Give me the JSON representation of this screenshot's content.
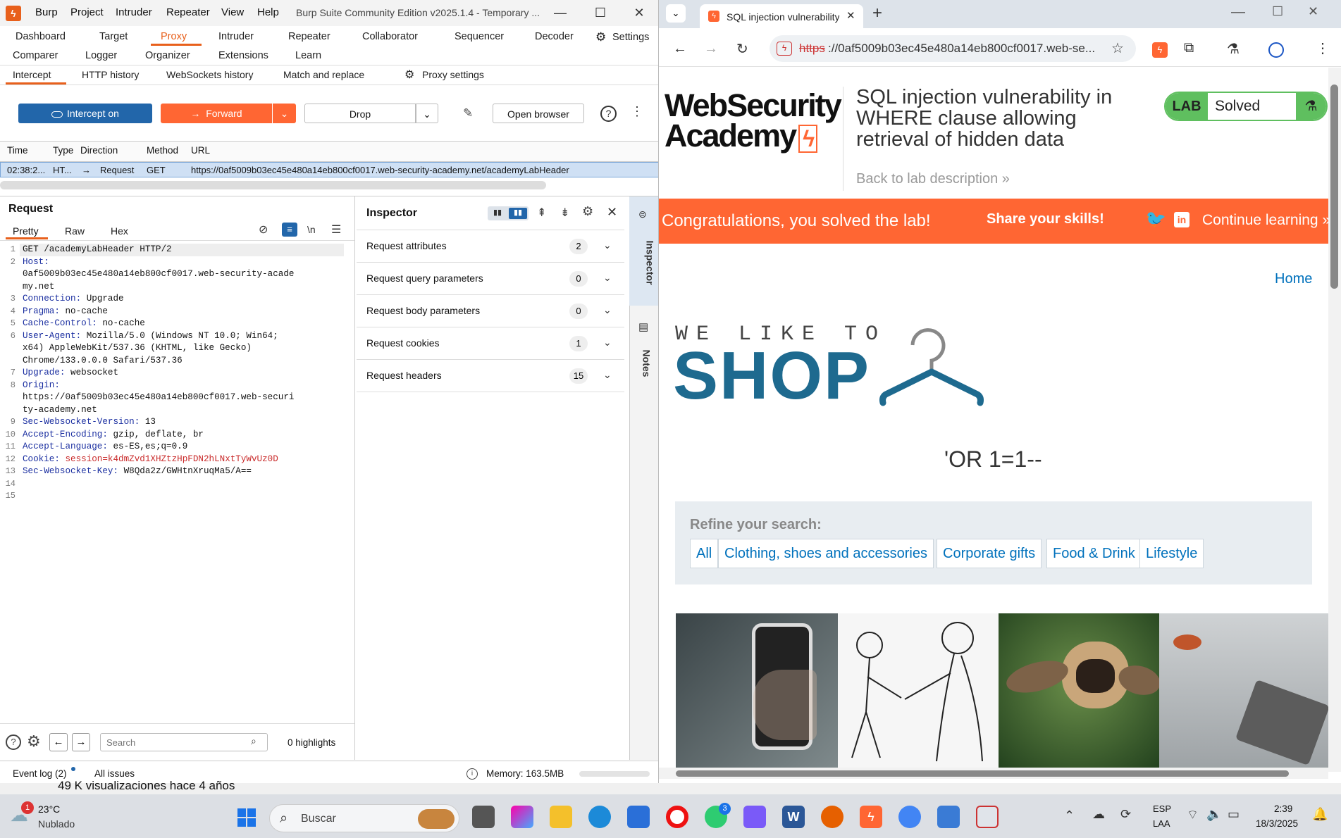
{
  "burp": {
    "menu": [
      "Burp",
      "Project",
      "Intruder",
      "Repeater",
      "View",
      "Help"
    ],
    "window_title": "Burp Suite Community Edition v2025.1.4 - Temporary ...",
    "tabs_row1": [
      "Dashboard",
      "Target",
      "Proxy",
      "Intruder",
      "Repeater",
      "Collaborator",
      "Sequencer",
      "Decoder"
    ],
    "settings_label": "Settings",
    "tabs_row2": [
      "Comparer",
      "Logger",
      "Organizer",
      "Extensions",
      "Learn"
    ],
    "proxy_subtabs": [
      "Intercept",
      "HTTP history",
      "WebSockets history",
      "Match and replace"
    ],
    "proxy_settings": "Proxy settings",
    "intercept_btn": "Intercept on",
    "forward_btn": "Forward",
    "drop_btn": "Drop",
    "open_browser_btn": "Open browser",
    "table_headers": [
      "Time",
      "Type",
      "Direction",
      "Method",
      "URL"
    ],
    "table_row": {
      "time": "02:38:2...",
      "type": "HT...",
      "direction": "Request",
      "method": "GET",
      "url": "https://0af5009b03ec45e480a14eb800cf0017.web-security-academy.net/academyLabHeader"
    },
    "request_title": "Request",
    "request_views": [
      "Pretty",
      "Raw",
      "Hex"
    ],
    "newline_label": "\\n",
    "request_lines": [
      {
        "n": "1",
        "k": "",
        "v": "GET /academyLabHeader HTTP/2"
      },
      {
        "n": "2",
        "k": "Host:",
        "v": ""
      },
      {
        "n": "",
        "k": "",
        "v": "0af5009b03ec45e480a14eb800cf0017.web-security-acade"
      },
      {
        "n": "",
        "k": "",
        "v": "my.net"
      },
      {
        "n": "3",
        "k": "Connection:",
        "v": " Upgrade"
      },
      {
        "n": "4",
        "k": "Pragma:",
        "v": " no-cache"
      },
      {
        "n": "5",
        "k": "Cache-Control:",
        "v": " no-cache"
      },
      {
        "n": "6",
        "k": "User-Agent:",
        "v": " Mozilla/5.0 (Windows NT 10.0; Win64;"
      },
      {
        "n": "",
        "k": "",
        "v": "x64) AppleWebKit/537.36 (KHTML, like Gecko)"
      },
      {
        "n": "",
        "k": "",
        "v": "Chrome/133.0.0.0 Safari/537.36"
      },
      {
        "n": "7",
        "k": "Upgrade:",
        "v": " websocket"
      },
      {
        "n": "8",
        "k": "Origin:",
        "v": ""
      },
      {
        "n": "",
        "k": "",
        "v": "https://0af5009b03ec45e480a14eb800cf0017.web-securi"
      },
      {
        "n": "",
        "k": "",
        "v": "ty-academy.net"
      },
      {
        "n": "9",
        "k": "Sec-Websocket-Version:",
        "v": " 13"
      },
      {
        "n": "10",
        "k": "Accept-Encoding:",
        "v": " gzip, deflate, br"
      },
      {
        "n": "11",
        "k": "Accept-Language:",
        "v": " es-ES,es;q=0.9"
      },
      {
        "n": "12",
        "k": "Cookie:",
        "v": " session=k4dmZvd1XHZtzHpFDN2hLNxtTyWvUz0D"
      },
      {
        "n": "13",
        "k": "Sec-Websocket-Key:",
        "v": " W8Qda2z/GWHtnXruqMa5/A=="
      },
      {
        "n": "14",
        "k": "",
        "v": ""
      },
      {
        "n": "15",
        "k": "",
        "v": ""
      }
    ],
    "inspector_title": "Inspector",
    "inspector_rows": [
      {
        "label": "Request attributes",
        "count": "2"
      },
      {
        "label": "Request query parameters",
        "count": "0"
      },
      {
        "label": "Request body parameters",
        "count": "0"
      },
      {
        "label": "Request cookies",
        "count": "1"
      },
      {
        "label": "Request headers",
        "count": "15"
      }
    ],
    "side_tabs": [
      "Inspector",
      "Notes"
    ],
    "search_placeholder": "Search",
    "highlights": "0 highlights",
    "event_log": "Event log (2)",
    "all_issues": "All issues",
    "memory": "Memory: 163.5MB"
  },
  "browser": {
    "tab_title": "SQL injection vulnerability in W",
    "url_struck": "https",
    "url_rest": "://0af5009b03ec45e480a14eb800cf0017.web-se...",
    "logo_line1": "WebSecurity",
    "logo_line2": "Academy",
    "lab_title": "SQL injection vulnerability in WHERE clause allowing retrieval of hidden data",
    "lab_badge": "LAB",
    "lab_status": "Solved",
    "back_link": "Back to lab description",
    "banner_text": "Congratulations, you solved the lab!",
    "share_text": "Share your skills!",
    "continue_text": "Continue learning",
    "home_link": "Home",
    "shop_tagline": "WE LIKE TO",
    "shop_word": "SHOP",
    "search_term": "'OR 1=1--",
    "refine_label": "Refine your search:",
    "categories": [
      "All",
      "Clothing, shoes and accessories",
      "Corporate gifts",
      "Food & Drink",
      "Lifestyle"
    ]
  },
  "behind": {
    "text": "49 K visualizaciones  hace 4 años"
  },
  "taskbar": {
    "weather_temp": "23°C",
    "weather_desc": "Nublado",
    "weather_badge": "1",
    "search": "Buscar",
    "whatsapp_badge": "3",
    "lang1": "ESP",
    "lang2": "LAA",
    "time": "2:39",
    "date": "18/3/2025"
  },
  "colors": {
    "burp_orange": "#e8601c",
    "intercept_blue": "#2266aa",
    "banner": "#ff6633",
    "lab_green": "#5fbf5f",
    "shop_blue": "#1e6a8f"
  }
}
